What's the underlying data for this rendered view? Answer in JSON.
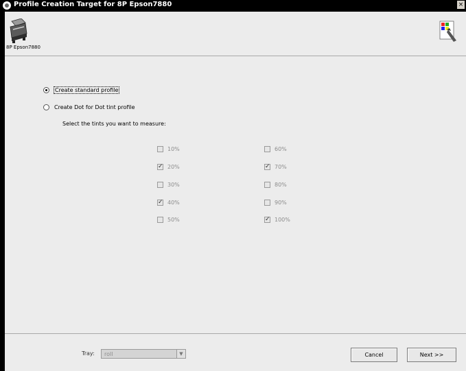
{
  "window": {
    "title": "Profile Creation Target for 8P Epson7880",
    "close_glyph": "×"
  },
  "header": {
    "printer_name": "8P Epson7880",
    "printer_icon": "printer-icon",
    "profile_icon": "color-profile-icon"
  },
  "options": {
    "standard_label": "Create standard profile",
    "standard_selected": true,
    "dot_label": "Create Dot for Dot tint profile",
    "dot_selected": false,
    "tints_prompt": "Select the tints you want to measure:"
  },
  "tints": [
    {
      "label": "10%",
      "checked": false
    },
    {
      "label": "20%",
      "checked": true
    },
    {
      "label": "30%",
      "checked": false
    },
    {
      "label": "40%",
      "checked": true
    },
    {
      "label": "50%",
      "checked": false
    },
    {
      "label": "60%",
      "checked": false
    },
    {
      "label": "70%",
      "checked": true
    },
    {
      "label": "80%",
      "checked": false
    },
    {
      "label": "90%",
      "checked": false
    },
    {
      "label": "100%",
      "checked": true
    }
  ],
  "footer": {
    "tray_label": "Tray:",
    "tray_value": "roll",
    "cancel_label": "Cancel",
    "next_label": "Next >>"
  }
}
